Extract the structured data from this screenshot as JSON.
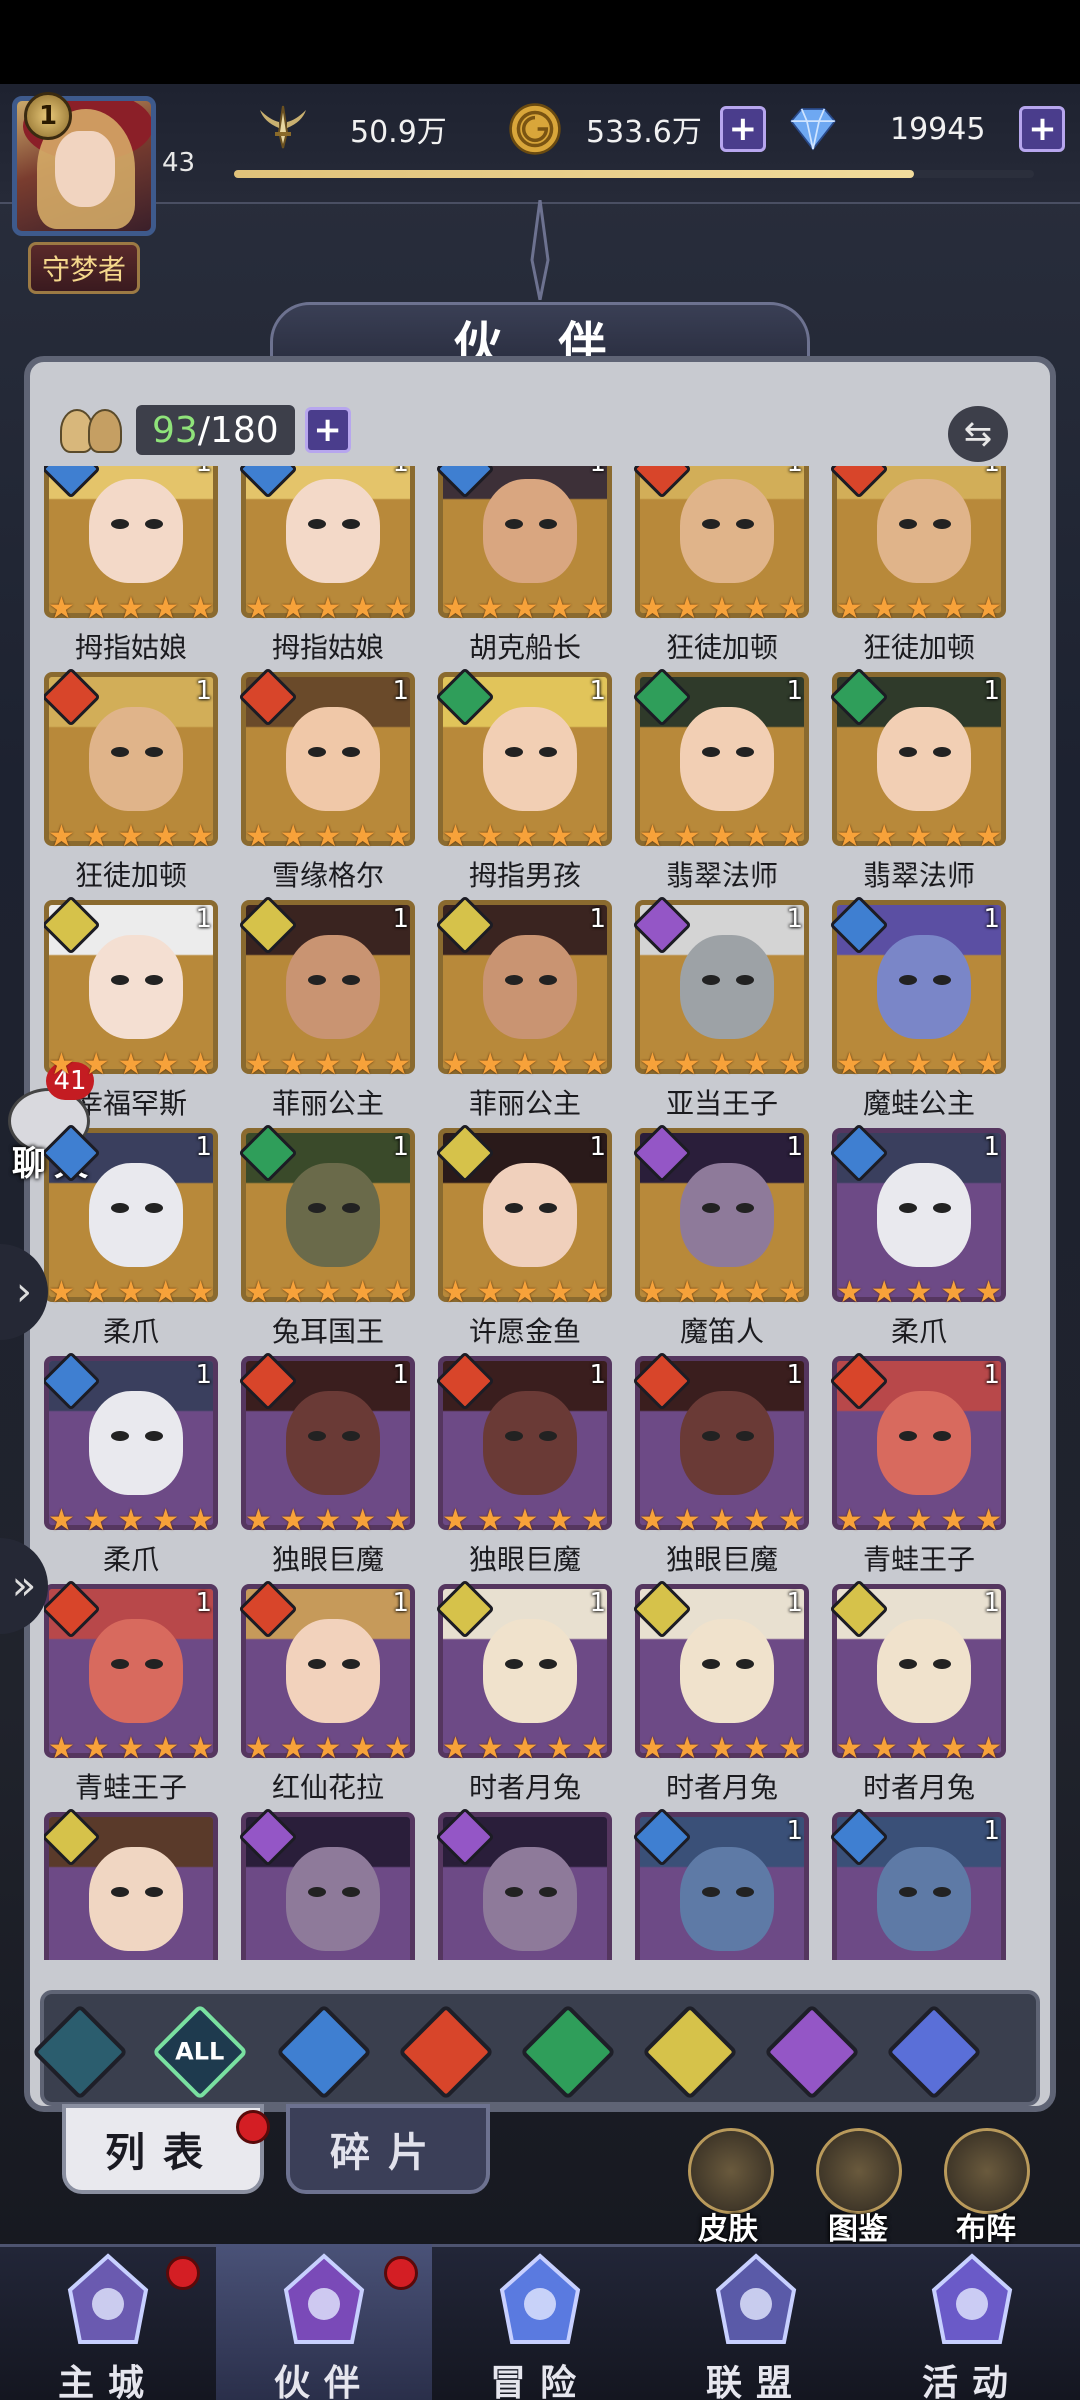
{
  "top": {
    "level_badge": "1",
    "player_level": "43",
    "title_badge": "守梦者",
    "power": "50.9万",
    "gold": "533.6万",
    "gems": "19945",
    "exp_fraction": 0.85
  },
  "page_title": "伙 伴",
  "capacity": {
    "current": "93",
    "max": "/180"
  },
  "heroes": [
    {
      "name": "拇指姑娘",
      "count": "1",
      "element": "water",
      "frame": "gold",
      "skin": "#f3d9c8",
      "hair": "#e4c46a"
    },
    {
      "name": "拇指姑娘",
      "count": "1",
      "element": "water",
      "frame": "gold",
      "skin": "#f3d9c8",
      "hair": "#e4c46a"
    },
    {
      "name": "胡克船长",
      "count": "1",
      "element": "water",
      "frame": "gold",
      "skin": "#d9a680",
      "hair": "#3d3038"
    },
    {
      "name": "狂徒加顿",
      "count": "1",
      "element": "fire",
      "frame": "gold",
      "skin": "#e0b48a",
      "hair": "#d2ae58"
    },
    {
      "name": "狂徒加顿",
      "count": "1",
      "element": "fire",
      "frame": "gold",
      "skin": "#e0b48a",
      "hair": "#d2ae58"
    },
    {
      "name": "狂徒加顿",
      "count": "1",
      "element": "fire",
      "frame": "gold",
      "skin": "#e0b48a",
      "hair": "#d2ae58"
    },
    {
      "name": "雪缘格尔",
      "count": "1",
      "element": "fire",
      "frame": "gold",
      "skin": "#f0c8a8",
      "hair": "#6a4a2a"
    },
    {
      "name": "拇指男孩",
      "count": "1",
      "element": "wind",
      "frame": "gold",
      "skin": "#f2cfb4",
      "hair": "#e1c45a"
    },
    {
      "name": "翡翠法师",
      "count": "1",
      "element": "wind",
      "frame": "gold",
      "skin": "#f2cfb4",
      "hair": "#2f3a2a"
    },
    {
      "name": "翡翠法师",
      "count": "1",
      "element": "wind",
      "frame": "gold",
      "skin": "#f2cfb4",
      "hair": "#2f3a2a"
    },
    {
      "name": "幸福罕斯",
      "count": "1",
      "element": "light",
      "frame": "gold",
      "skin": "#f4dfd2",
      "hair": "#ececec"
    },
    {
      "name": "菲丽公主",
      "count": "1",
      "element": "light",
      "frame": "gold",
      "skin": "#c99472",
      "hair": "#3a2420"
    },
    {
      "name": "菲丽公主",
      "count": "1",
      "element": "light",
      "frame": "gold",
      "skin": "#c99472",
      "hair": "#3a2420"
    },
    {
      "name": "亚当王子",
      "count": "1",
      "element": "dark",
      "frame": "gold",
      "skin": "#9da2a6",
      "hair": "#d4d4d4"
    },
    {
      "name": "魔蛙公主",
      "count": "1",
      "element": "water",
      "frame": "gold",
      "skin": "#7a86c8",
      "hair": "#5b4fa3"
    },
    {
      "name": "柔爪",
      "count": "1",
      "element": "water",
      "frame": "gold",
      "skin": "#e9e9ee",
      "hair": "#3a3f5e"
    },
    {
      "name": "兔耳国王",
      "count": "1",
      "element": "wind",
      "frame": "gold",
      "skin": "#6a6a4a",
      "hair": "#3a4a2a"
    },
    {
      "name": "许愿金鱼",
      "count": "1",
      "element": "light",
      "frame": "gold",
      "skin": "#f0d0bc",
      "hair": "#2a1a1a"
    },
    {
      "name": "魔笛人",
      "count": "1",
      "element": "dark",
      "frame": "gold",
      "skin": "#8e7a9a",
      "hair": "#2a1e3a"
    },
    {
      "name": "柔爪",
      "count": "1",
      "element": "water",
      "frame": "purple",
      "skin": "#e9e9ee",
      "hair": "#3a3f5e"
    },
    {
      "name": "柔爪",
      "count": "1",
      "element": "water",
      "frame": "purple",
      "skin": "#e9e9ee",
      "hair": "#3a3f5e"
    },
    {
      "name": "独眼巨魔",
      "count": "1",
      "element": "fire",
      "frame": "purple",
      "skin": "#6a3a36",
      "hair": "#3a1e1e"
    },
    {
      "name": "独眼巨魔",
      "count": "1",
      "element": "fire",
      "frame": "purple",
      "skin": "#6a3a36",
      "hair": "#3a1e1e"
    },
    {
      "name": "独眼巨魔",
      "count": "1",
      "element": "fire",
      "frame": "purple",
      "skin": "#6a3a36",
      "hair": "#3a1e1e"
    },
    {
      "name": "青蛙王子",
      "count": "1",
      "element": "fire",
      "frame": "purple",
      "skin": "#d86a5e",
      "hair": "#b8484a"
    },
    {
      "name": "青蛙王子",
      "count": "1",
      "element": "fire",
      "frame": "purple",
      "skin": "#d86a5e",
      "hair": "#b8484a"
    },
    {
      "name": "红仙花拉",
      "count": "1",
      "element": "fire",
      "frame": "purple",
      "skin": "#f2d2bc",
      "hair": "#c69a5a"
    },
    {
      "name": "时者月兔",
      "count": "1",
      "element": "light",
      "frame": "purple",
      "skin": "#f0e2cc",
      "hair": "#e8e0d0"
    },
    {
      "name": "时者月兔",
      "count": "1",
      "element": "light",
      "frame": "purple",
      "skin": "#f0e2cc",
      "hair": "#e8e0d0"
    },
    {
      "name": "时者月兔",
      "count": "1",
      "element": "light",
      "frame": "purple",
      "skin": "#f0e2cc",
      "hair": "#e8e0d0"
    },
    {
      "name": "",
      "count": "",
      "element": "light",
      "frame": "purple",
      "skin": "#f0d6c2",
      "hair": "#5a3a2a"
    },
    {
      "name": "",
      "count": "",
      "element": "dark",
      "frame": "purple",
      "skin": "#8e7a9a",
      "hair": "#2a1e3a"
    },
    {
      "name": "",
      "count": "",
      "element": "dark",
      "frame": "purple",
      "skin": "#8e7a9a",
      "hair": "#2a1e3a"
    },
    {
      "name": "",
      "count": "1",
      "element": "water",
      "frame": "purple",
      "skin": "#5e7aa6",
      "hair": "#3a5078"
    },
    {
      "name": "",
      "count": "1",
      "element": "water",
      "frame": "purple",
      "skin": "#5e7aa6",
      "hair": "#3a5078"
    }
  ],
  "element_colors": {
    "water": "#3f7fd1",
    "fire": "#d8452a",
    "wind": "#2f9e5a",
    "light": "#d6c24a",
    "dark": "#9456c6",
    "all": "#1e3a4e",
    "void": "#5a6fd8",
    "base": "#2b5d6e"
  },
  "filters": [
    {
      "key": "base",
      "label": ""
    },
    {
      "key": "all",
      "label": "ALL"
    },
    {
      "key": "water",
      "label": ""
    },
    {
      "key": "fire",
      "label": ""
    },
    {
      "key": "wind",
      "label": ""
    },
    {
      "key": "light",
      "label": ""
    },
    {
      "key": "dark",
      "label": ""
    },
    {
      "key": "void",
      "label": ""
    }
  ],
  "subtabs": {
    "list": "列表",
    "fragments": "碎片"
  },
  "side_buttons": {
    "skin": "皮肤",
    "atlas": "图鉴",
    "formation": "布阵"
  },
  "chat": {
    "count": "41",
    "label": "聊天"
  },
  "nav": [
    {
      "label": "主城",
      "icon": "castle-icon"
    },
    {
      "label": "伙伴",
      "icon": "witch-hat-icon"
    },
    {
      "label": "冒险",
      "icon": "portal-icon"
    },
    {
      "label": "联盟",
      "icon": "shield-icon"
    },
    {
      "label": "活动",
      "icon": "cards-icon"
    }
  ]
}
